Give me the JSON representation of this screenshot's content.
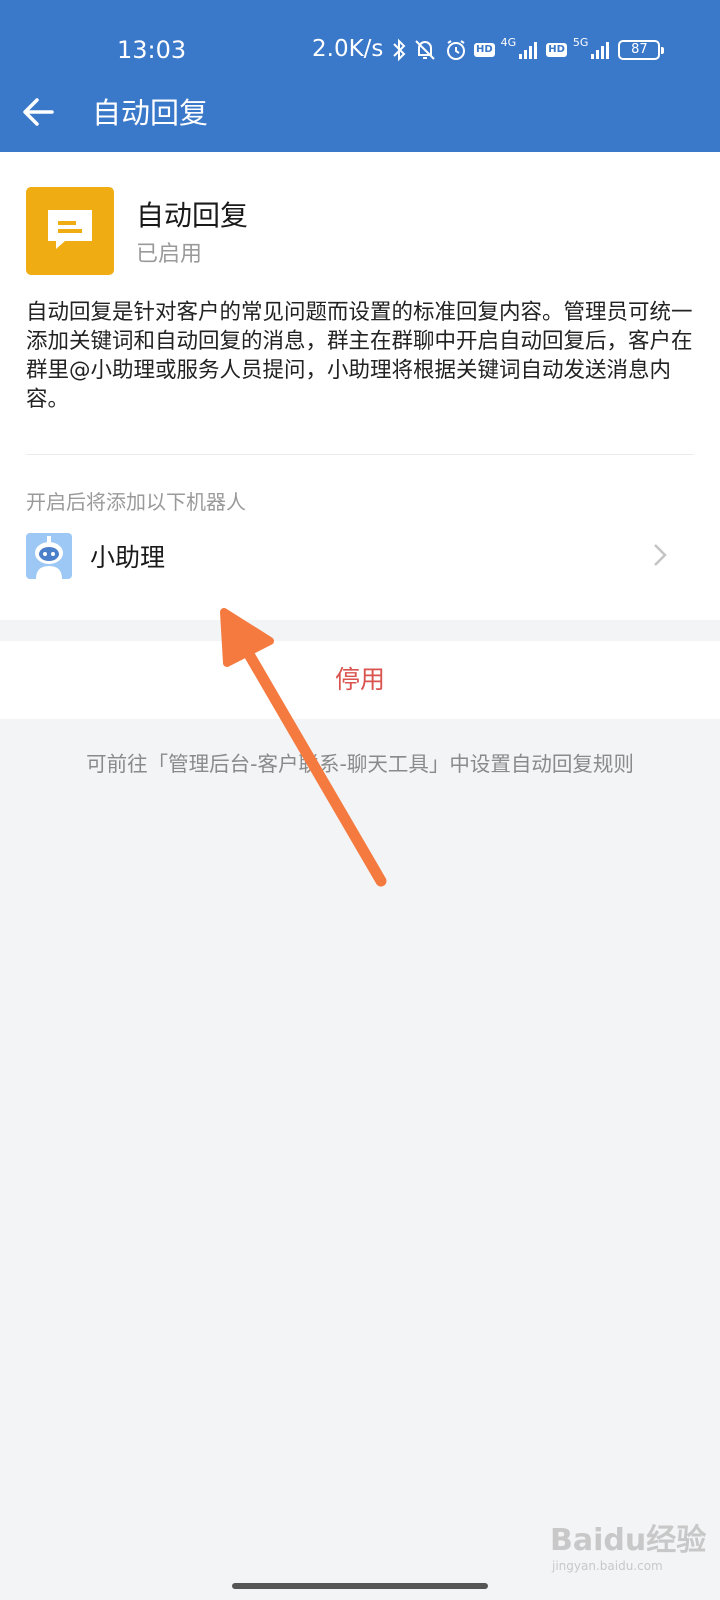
{
  "status_bar": {
    "time": "13:03",
    "speed": "2.0K/s",
    "hd1": "HD",
    "net1": "4G",
    "hd2": "HD",
    "net2": "5G",
    "battery": "87"
  },
  "header": {
    "title": "自动回复"
  },
  "feature": {
    "name": "自动回复",
    "status": "已启用",
    "icon": "message-icon",
    "icon_color": "#f0ad13",
    "description": "自动回复是针对客户的常见问题而设置的标准回复内容。管理员可统一添加关键词和自动回复的消息，群主在群聊中开启自动回复后，客户在群里@小助理或服务人员提问，小助理将根据关键词自动发送消息内容。"
  },
  "robots": {
    "section_label": "开启后将添加以下机器人",
    "items": [
      {
        "name": "小助理",
        "icon": "robot-icon"
      }
    ]
  },
  "actions": {
    "stop_label": "停用",
    "stop_color": "#d9534f"
  },
  "hint": "可前往「管理后台-客户联系-聊天工具」中设置自动回复规则",
  "watermark": {
    "brand": "Baidu经验",
    "sub": "jingyan.baidu.com"
  },
  "colors": {
    "header_bg": "#3a78c9",
    "annotation_arrow": "#f47a3f"
  }
}
